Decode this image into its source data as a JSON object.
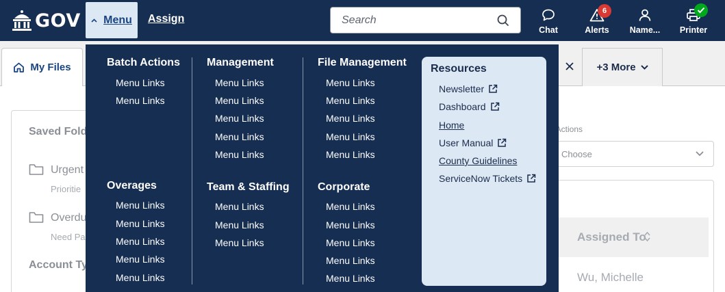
{
  "header": {
    "logo_text": "GOV",
    "menu_label": "Menu",
    "assign_label": "Assign",
    "search_placeholder": "Search",
    "items": [
      {
        "label": "Chat",
        "icon": "chat-bubble-icon"
      },
      {
        "label": "Alerts",
        "icon": "alert-triangle-icon",
        "badge": "6"
      },
      {
        "label": "Name...",
        "icon": "user-icon"
      },
      {
        "label": "Printer",
        "icon": "printer-icon",
        "status": "check"
      }
    ]
  },
  "tabs": {
    "my_files": "My Files",
    "more": "+3 More"
  },
  "background": {
    "saved_folders_title": "Saved Fold",
    "folders": [
      {
        "name": "Urgent",
        "sub": "Prioritie"
      },
      {
        "name": "Overdu",
        "sub": "Need Pa"
      }
    ],
    "account_type_label": "Account Ty",
    "bulk_actions_label": "k Actions",
    "bulk_select_value": "Choose",
    "table_header": "Assigned To",
    "table_cell": "Wu, Michelle"
  },
  "mega_menu": {
    "columns": [
      {
        "title": "Batch Actions",
        "links": [
          "Menu Links",
          "Menu Links"
        ]
      },
      {
        "title": "Overages",
        "links": [
          "Menu Links",
          "Menu Links",
          "Menu Links",
          "Menu Links",
          "Menu Links"
        ]
      },
      {
        "title": "Management",
        "links": [
          "Menu Links",
          "Menu Links",
          "Menu Links",
          "Menu Links",
          "Menu Links"
        ]
      },
      {
        "title": "Team & Staffing",
        "links": [
          "Menu Links",
          "Menu Links",
          "Menu Links"
        ]
      },
      {
        "title": "File Management",
        "links": [
          "Menu Links",
          "Menu Links",
          "Menu Links",
          "Menu Links",
          "Menu Links"
        ]
      },
      {
        "title": "Corporate",
        "links": [
          "Menu Links",
          "Menu Links",
          "Menu Links",
          "Menu Links",
          "Menu Links"
        ]
      }
    ],
    "resources": {
      "title": "Resources",
      "links": [
        {
          "label": "Newsletter",
          "external": true
        },
        {
          "label": "Dashboard",
          "external": true
        },
        {
          "label": "Home",
          "external": false
        },
        {
          "label": "User Manual",
          "external": true
        },
        {
          "label": "County Guidelines",
          "external": false
        },
        {
          "label": "ServiceNow Tickets",
          "external": true
        }
      ]
    }
  },
  "colors": {
    "navy": "#162e51",
    "light_blue": "#dce9f5",
    "link_blue": "#1a4480",
    "alert_red": "#d83933",
    "success_green": "#00a91c"
  }
}
